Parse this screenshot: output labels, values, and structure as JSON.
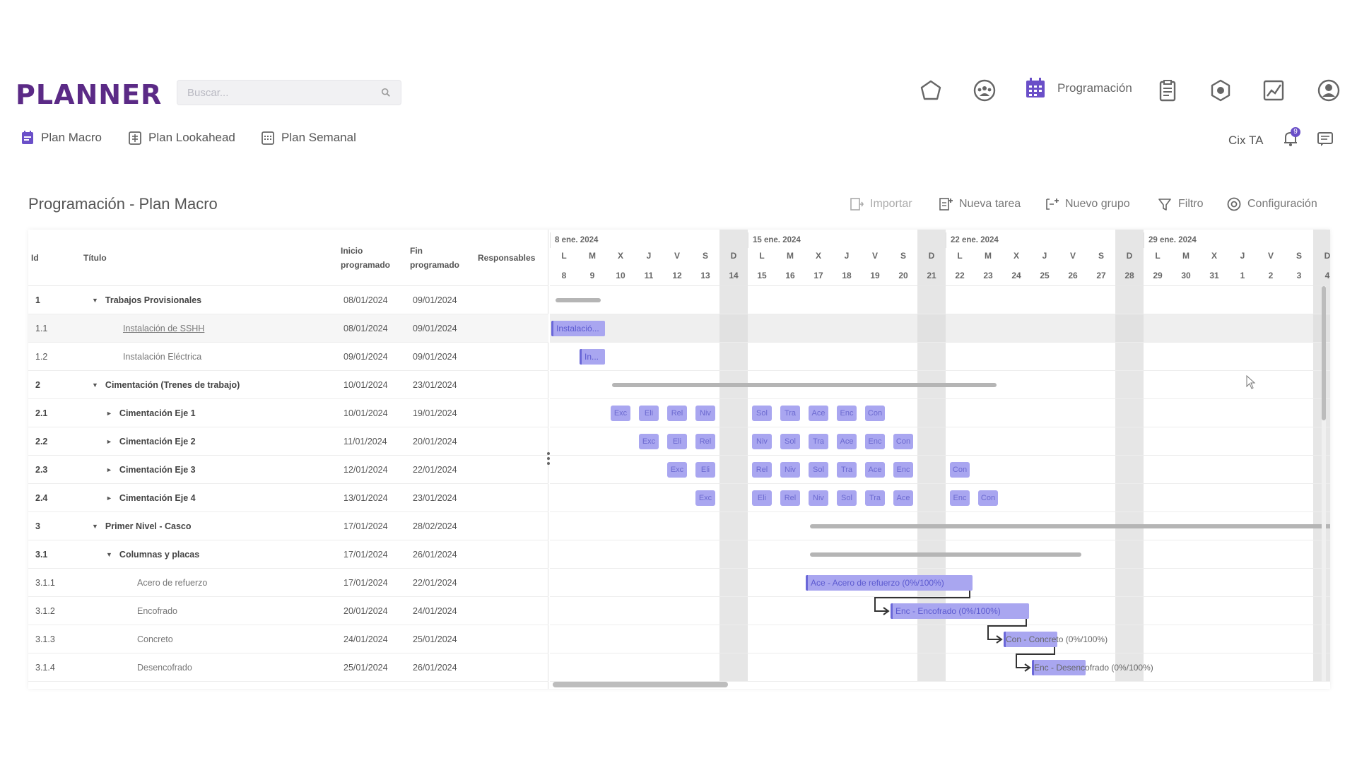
{
  "app": {
    "logo": "PLANNER"
  },
  "search": {
    "placeholder": "Buscar..."
  },
  "topnav": {
    "active_label": "Programación"
  },
  "subnav": [
    {
      "label": "Plan Macro"
    },
    {
      "label": "Plan Lookahead"
    },
    {
      "label": "Plan Semanal"
    }
  ],
  "user": {
    "name": "Cix TA",
    "notifications": "9"
  },
  "page": {
    "title": "Programación - Plan Macro"
  },
  "toolbar": {
    "import": "Importar",
    "new_task": "Nueva tarea",
    "new_group": "Nuevo grupo",
    "filter": "Filtro",
    "config": "Configuración"
  },
  "colors": {
    "brand": "#5b2a86",
    "accent": "#6a4fc8",
    "task": "#a9a6f0"
  },
  "table": {
    "headers": {
      "id": "Id",
      "title": "Título",
      "start_l1": "Inicio",
      "start_l2": "programado",
      "end_l1": "Fin",
      "end_l2": "programado",
      "resp": "Responsables"
    },
    "rows": [
      {
        "id": "1",
        "title": "Trabajos Provisionales",
        "start": "08/01/2024",
        "end": "09/01/2024",
        "toggle": "▼"
      },
      {
        "id": "1.1",
        "title": "Instalación de SSHH",
        "start": "08/01/2024",
        "end": "09/01/2024"
      },
      {
        "id": "1.2",
        "title": "Instalación Eléctrica",
        "start": "09/01/2024",
        "end": "09/01/2024"
      },
      {
        "id": "2",
        "title": "Cimentación (Trenes de trabajo)",
        "start": "10/01/2024",
        "end": "23/01/2024",
        "toggle": "▼"
      },
      {
        "id": "2.1",
        "title": "Cimentación Eje 1",
        "start": "10/01/2024",
        "end": "19/01/2024",
        "toggle": "►"
      },
      {
        "id": "2.2",
        "title": "Cimentación Eje 2",
        "start": "11/01/2024",
        "end": "20/01/2024",
        "toggle": "►"
      },
      {
        "id": "2.3",
        "title": "Cimentación Eje 3",
        "start": "12/01/2024",
        "end": "22/01/2024",
        "toggle": "►"
      },
      {
        "id": "2.4",
        "title": "Cimentación Eje 4",
        "start": "13/01/2024",
        "end": "23/01/2024",
        "toggle": "►"
      },
      {
        "id": "3",
        "title": "Primer Nivel - Casco",
        "start": "17/01/2024",
        "end": "28/02/2024",
        "toggle": "▼"
      },
      {
        "id": "3.1",
        "title": "Columnas y placas",
        "start": "17/01/2024",
        "end": "26/01/2024",
        "toggle": "▼"
      },
      {
        "id": "3.1.1",
        "title": "Acero de refuerzo",
        "start": "17/01/2024",
        "end": "22/01/2024"
      },
      {
        "id": "3.1.2",
        "title": "Encofrado",
        "start": "20/01/2024",
        "end": "24/01/2024"
      },
      {
        "id": "3.1.3",
        "title": "Concreto",
        "start": "24/01/2024",
        "end": "25/01/2024"
      },
      {
        "id": "3.1.4",
        "title": "Desencofrado",
        "start": "25/01/2024",
        "end": "26/01/2024"
      }
    ]
  },
  "gantt": {
    "weeks": [
      "8 ene. 2024",
      "15 ene. 2024",
      "22 ene. 2024",
      "29 ene. 2024"
    ],
    "day_letters": [
      "L",
      "M",
      "X",
      "J",
      "V",
      "S",
      "D",
      "L",
      "M",
      "X",
      "J",
      "V",
      "S",
      "D",
      "L",
      "M",
      "X",
      "J",
      "V",
      "S",
      "D",
      "L",
      "M",
      "X",
      "J",
      "V",
      "S",
      "D"
    ],
    "day_numbers": [
      "8",
      "9",
      "10",
      "11",
      "12",
      "13",
      "14",
      "15",
      "16",
      "17",
      "18",
      "19",
      "20",
      "21",
      "22",
      "23",
      "24",
      "25",
      "26",
      "27",
      "28",
      "29",
      "30",
      "31",
      "1",
      "2",
      "3",
      "4"
    ],
    "bars": {
      "r1_1": "Instalació...",
      "r1_2": "In...",
      "r3_1_1": "Ace - Acero de refuerzo (0%/100%)",
      "r3_1_2": "Enc - Encofrado (0%/100%)",
      "r3_1_3": "Con - Concreto (0%/100%)",
      "r3_1_4": "Enc - Desencofrado (0%/100%)"
    },
    "chips": {
      "r2_1": [
        "Exc",
        "Eli",
        "Rel",
        "Niv",
        "Sol",
        "Tra",
        "Ace",
        "Enc",
        "Con"
      ],
      "r2_2": [
        "Exc",
        "Eli",
        "Rel",
        "Niv",
        "Sol",
        "Tra",
        "Ace",
        "Enc",
        "Con"
      ],
      "r2_3": [
        "Exc",
        "Eli",
        "Rel",
        "Niv",
        "Sol",
        "Tra",
        "Ace",
        "Enc",
        "Con"
      ],
      "r2_4": [
        "Exc",
        "Eli",
        "Rel",
        "Niv",
        "Sol",
        "Tra",
        "Ace",
        "Enc",
        "Con"
      ]
    }
  }
}
